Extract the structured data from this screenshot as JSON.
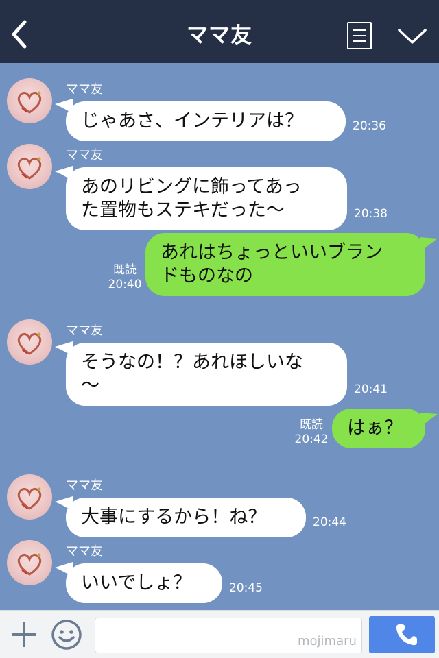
{
  "header": {
    "title": "ママ友",
    "back_icon": "chevron-left-icon",
    "menu_icon": "list-icon",
    "expand_icon": "chevron-down-icon"
  },
  "messages": [
    {
      "sender": "ママ友",
      "text_lines": [
        "じゃあさ、インテリアは？"
      ],
      "time": "20:36"
    },
    {
      "sender": "ママ友",
      "text_lines": [
        "あのリビングに飾ってあっ",
        "た置物もステキだった〜"
      ],
      "time": "20:38"
    },
    {
      "read_label": "既読",
      "text_lines": [
        "あれはちょっといいブラン",
        "ドものなの"
      ],
      "time": "20:40"
    },
    {
      "sender": "ママ友",
      "text_lines": [
        "そうなの！？あれほしいな",
        "〜"
      ],
      "time": "20:41"
    },
    {
      "read_label": "既読",
      "text_lines": [
        "はぁ？"
      ],
      "time": "20:42"
    },
    {
      "sender": "ママ友",
      "text_lines": [
        "大事にするから！ね？"
      ],
      "time": "20:44"
    },
    {
      "sender": "ママ友",
      "text_lines": [
        "いいでしょ？"
      ],
      "time": "20:45"
    }
  ],
  "input_bar": {
    "plus_icon": "plus-icon",
    "emoji_icon": "smiley-icon",
    "call_icon": "phone-icon",
    "watermark": "mojimaru"
  },
  "colors": {
    "header_bg": "#252f45",
    "chat_bg": "#7293c1",
    "received_bubble": "#ffffff",
    "sent_bubble": "#86e14a",
    "call_button": "#4f86e8"
  }
}
